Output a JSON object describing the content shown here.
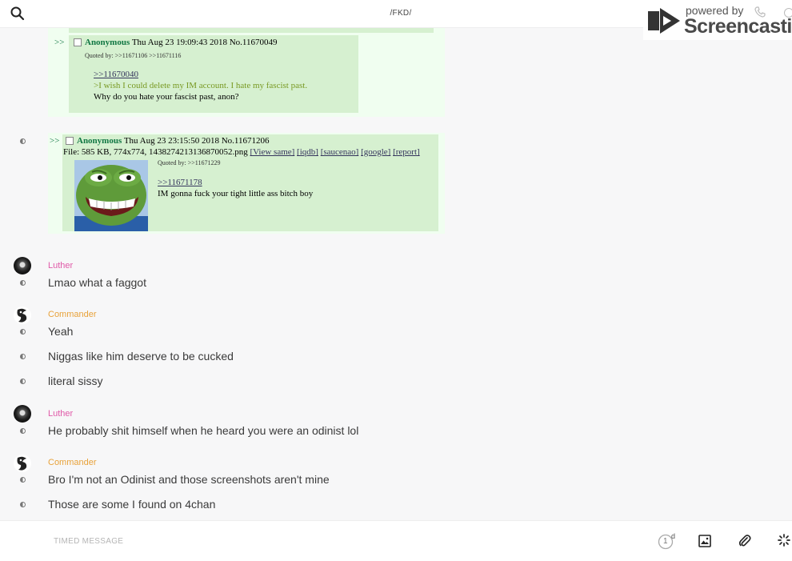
{
  "header": {
    "title": "/FKD/",
    "watermark_small": "powered by",
    "watermark_big": "Screencastify"
  },
  "shot1": {
    "arrows": ">>",
    "name": "Anonymous",
    "datetime": "Thu Aug 23 19:09:43 2018 No.11670049",
    "quoted_by": "Quoted by: >>11671106 >>11671116",
    "reply_link": ">>11670040",
    "greentext": ">I wish I could delete my IM account. I hate my fascist past.",
    "body": "Why do you hate your fascist past, anon?"
  },
  "shot2": {
    "arrows": ">>",
    "name": "Anonymous",
    "datetime": "Thu Aug 23 23:15:50 2018 No.11671206",
    "file_info": "File: 585 KB, 774x774, 1438274213136870052.png",
    "links": [
      "[View same]",
      "[iqdb]",
      "[saucenao]",
      "[google]",
      "[report]"
    ],
    "quoted_by": "Quoted by: >>11671229",
    "reply_link": ">>11671178",
    "body": "IM gonna fuck your tight little ass bitch boy"
  },
  "messages": [
    {
      "author": "Luther",
      "text": "Lmao what a faggot"
    },
    {
      "author": "Commander",
      "text": "Yeah"
    },
    {
      "author": "",
      "text": "Niggas like him deserve to be cucked"
    },
    {
      "author": "",
      "text": "literal sissy"
    },
    {
      "author": "Luther",
      "text": "He probably shit himself when he heard you were an odinist lol"
    },
    {
      "author": "Commander",
      "text": "Bro I'm not an Odinist and those screenshots aren't mine"
    },
    {
      "author": "",
      "text": "Those are some I found on 4chan"
    }
  ],
  "composer": {
    "placeholder": "TIMED MESSAGE",
    "timer_value": "1",
    "timer_unit": "d"
  },
  "icons": [
    "search-icon",
    "phone-icon",
    "info-icon",
    "image-icon",
    "paperclip-icon",
    "spinner-icon"
  ],
  "colors": {
    "luther": "#e05aa8",
    "commander": "#e8a23a",
    "post_bg": "#d6f0d0",
    "post_name": "#117743",
    "greentext": "#789922"
  }
}
